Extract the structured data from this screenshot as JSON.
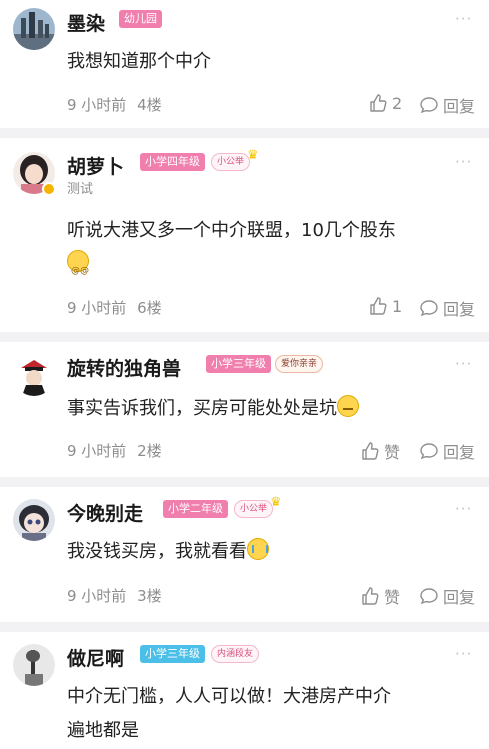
{
  "comments": [
    {
      "name": "墨染",
      "level": "幼儿园",
      "level_color": "#f07fae",
      "subtitle": "",
      "content": "我想知道那个中介",
      "emoji": "",
      "time": "9 小时前",
      "floor": "4楼",
      "likes": "2",
      "reply": "回复"
    },
    {
      "name": "胡萝卜",
      "level": "小学四年级",
      "level_color": "#f07fae",
      "medal": "小公举",
      "subtitle": "测试",
      "content": "听说大港又多一个中介联盟，10几个股东",
      "emoji": "dizzy-face-emoji",
      "time": "9 小时前",
      "floor": "6楼",
      "likes": "1",
      "reply": "回复"
    },
    {
      "name": "旋转的独角兽",
      "level": "小学三年级",
      "level_color": "#f07fae",
      "medal": "爱你亲亲",
      "content": "事实告诉我们，买房可能处处是坑",
      "emoji": "sweat-face-emoji",
      "time": "9 小时前",
      "floor": "2楼",
      "likes": "赞",
      "reply": "回复"
    },
    {
      "name": "今晚别走",
      "level": "小学二年级",
      "level_color": "#f07fae",
      "medal": "小公举",
      "content": "我没钱买房，我就看看",
      "emoji": "crying-face-emoji",
      "time": "9 小时前",
      "floor": "3楼",
      "likes": "赞",
      "reply": "回复"
    },
    {
      "name": "做尼啊",
      "level": "小学三年级",
      "level_color": "#4cbfe8",
      "medal": "内涵段友",
      "content_line1": "中介无门槛，人人可以做！大港房产中介",
      "content_line2": "遍地都是"
    }
  ]
}
